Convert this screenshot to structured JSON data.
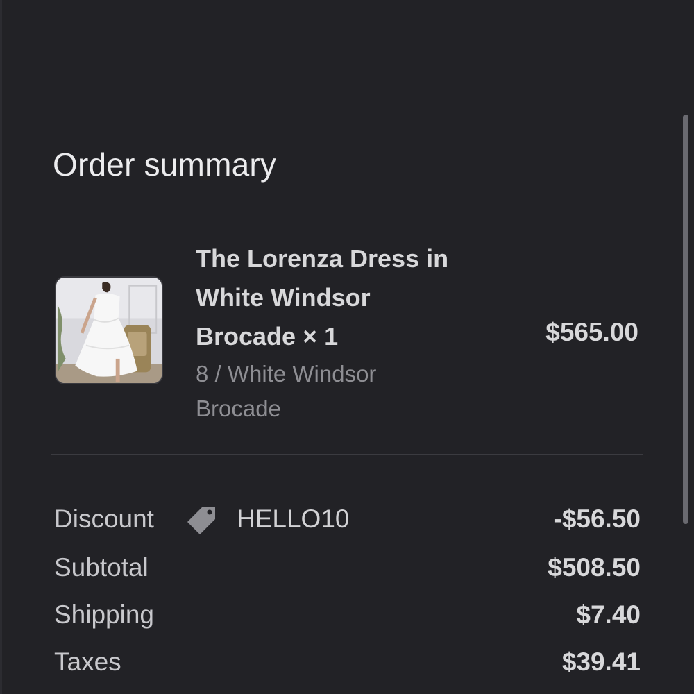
{
  "order_summary": {
    "heading": "Order summary",
    "item": {
      "title": "The Lorenza Dress in\nWhite Windsor\nBrocade × 1",
      "variant": "8 / White Windsor\nBrocade",
      "price": "$565.00"
    },
    "lines": {
      "discount_label": "Discount",
      "discount_code": "HELLO10",
      "discount_value": "-$56.50",
      "subtotal_label": "Subtotal",
      "subtotal_value": "$508.50",
      "shipping_label": "Shipping",
      "shipping_value": "$7.40",
      "taxes_label": "Taxes",
      "taxes_value": "$39.41"
    }
  },
  "icons": {
    "discount": "tag-icon",
    "product": "product-thumbnail"
  },
  "colors": {
    "background": "#222226",
    "text_primary": "#d8d8da",
    "text_secondary": "#8e8e93",
    "divider": "#3b3b40"
  }
}
